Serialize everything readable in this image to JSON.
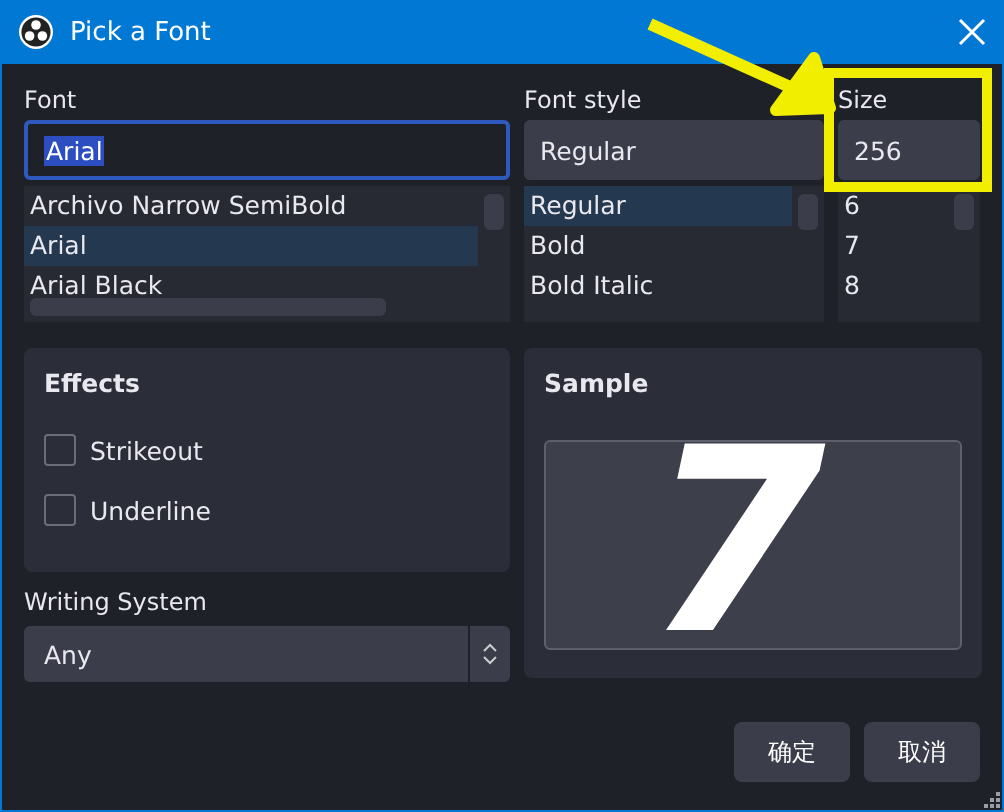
{
  "window": {
    "title": "Pick a Font"
  },
  "font": {
    "label": "Font",
    "value": "Arial",
    "items": [
      {
        "label": "Archivo Narrow SemiBold",
        "selected": false
      },
      {
        "label": "Arial",
        "selected": true
      },
      {
        "label": "Arial Black",
        "selected": false
      }
    ]
  },
  "font_style": {
    "label": "Font style",
    "value": "Regular",
    "items": [
      {
        "label": "Regular",
        "selected": true
      },
      {
        "label": "Bold",
        "selected": false
      },
      {
        "label": "Bold Italic",
        "selected": false
      }
    ]
  },
  "size": {
    "label": "Size",
    "value": "256",
    "items": [
      {
        "label": "6",
        "selected": false
      },
      {
        "label": "7",
        "selected": false
      },
      {
        "label": "8",
        "selected": false
      }
    ]
  },
  "effects": {
    "title": "Effects",
    "options": [
      {
        "label": "Strikeout",
        "checked": false
      },
      {
        "label": "Underline",
        "checked": false
      }
    ]
  },
  "writing_system": {
    "label": "Writing System",
    "value": "Any"
  },
  "sample": {
    "title": "Sample",
    "text": "7"
  },
  "buttons": [
    "确定",
    "取消"
  ]
}
